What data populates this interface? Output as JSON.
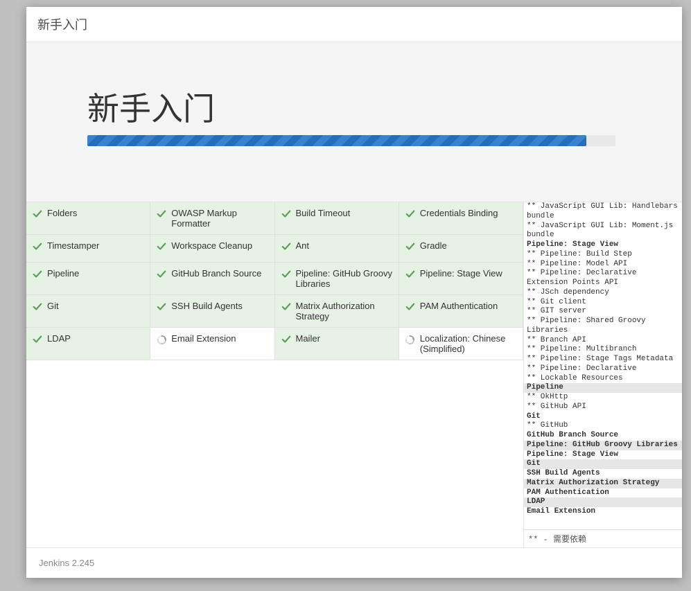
{
  "header": {
    "title": "新手入门"
  },
  "banner": {
    "title": "新手入门",
    "progress_percent": 94.5
  },
  "plugins": [
    {
      "label": "Folders",
      "status": "done"
    },
    {
      "label": "OWASP Markup Formatter",
      "status": "done"
    },
    {
      "label": "Build Timeout",
      "status": "done"
    },
    {
      "label": "Credentials Binding",
      "status": "done"
    },
    {
      "label": "Timestamper",
      "status": "done"
    },
    {
      "label": "Workspace Cleanup",
      "status": "done"
    },
    {
      "label": "Ant",
      "status": "done"
    },
    {
      "label": "Gradle",
      "status": "done"
    },
    {
      "label": "Pipeline",
      "status": "done"
    },
    {
      "label": "GitHub Branch Source",
      "status": "done"
    },
    {
      "label": "Pipeline: GitHub Groovy Libraries",
      "status": "done"
    },
    {
      "label": "Pipeline: Stage View",
      "status": "done"
    },
    {
      "label": "Git",
      "status": "done"
    },
    {
      "label": "SSH Build Agents",
      "status": "done"
    },
    {
      "label": "Matrix Authorization Strategy",
      "status": "done"
    },
    {
      "label": "PAM Authentication",
      "status": "done"
    },
    {
      "label": "LDAP",
      "status": "done"
    },
    {
      "label": "Email Extension",
      "status": "loading"
    },
    {
      "label": "Mailer",
      "status": "done"
    },
    {
      "label": "Localization: Chinese (Simplified)",
      "status": "loading"
    }
  ],
  "log": [
    {
      "text": "** JavaScript GUI Lib: Handlebars bundle",
      "style": "normal"
    },
    {
      "text": "** JavaScript GUI Lib: Moment.js bundle",
      "style": "normal"
    },
    {
      "text": "Pipeline: Stage View",
      "style": "bold"
    },
    {
      "text": "** Pipeline: Build Step",
      "style": "normal"
    },
    {
      "text": "** Pipeline: Model API",
      "style": "normal"
    },
    {
      "text": "** Pipeline: Declarative Extension Points API",
      "style": "normal"
    },
    {
      "text": "** JSch dependency",
      "style": "normal"
    },
    {
      "text": "** Git client",
      "style": "normal"
    },
    {
      "text": "** GIT server",
      "style": "normal"
    },
    {
      "text": "** Pipeline: Shared Groovy Libraries",
      "style": "normal"
    },
    {
      "text": "** Branch API",
      "style": "normal"
    },
    {
      "text": "** Pipeline: Multibranch",
      "style": "normal"
    },
    {
      "text": "** Pipeline: Stage Tags Metadata",
      "style": "normal"
    },
    {
      "text": "** Pipeline: Declarative",
      "style": "normal"
    },
    {
      "text": "** Lockable Resources",
      "style": "normal"
    },
    {
      "text": "Pipeline",
      "style": "highlight"
    },
    {
      "text": "** OkHttp",
      "style": "normal"
    },
    {
      "text": "** GitHub API",
      "style": "normal"
    },
    {
      "text": "Git",
      "style": "bold"
    },
    {
      "text": "** GitHub",
      "style": "normal"
    },
    {
      "text": "GitHub Branch Source",
      "style": "bold"
    },
    {
      "text": "Pipeline: GitHub Groovy Libraries",
      "style": "highlight"
    },
    {
      "text": "Pipeline: Stage View",
      "style": "bold"
    },
    {
      "text": "Git",
      "style": "highlight"
    },
    {
      "text": "SSH Build Agents",
      "style": "bold"
    },
    {
      "text": "Matrix Authorization Strategy",
      "style": "highlight"
    },
    {
      "text": "PAM Authentication",
      "style": "bold"
    },
    {
      "text": "LDAP",
      "style": "highlight"
    },
    {
      "text": "Email Extension",
      "style": "bold"
    }
  ],
  "log_footer": "** - 需要依赖",
  "footer": {
    "version": "Jenkins 2.245"
  },
  "colors": {
    "accent": "#246fbb",
    "done_bg": "#e6f2e4",
    "check": "#5d9e58",
    "spinner": "#9e9e9e"
  }
}
